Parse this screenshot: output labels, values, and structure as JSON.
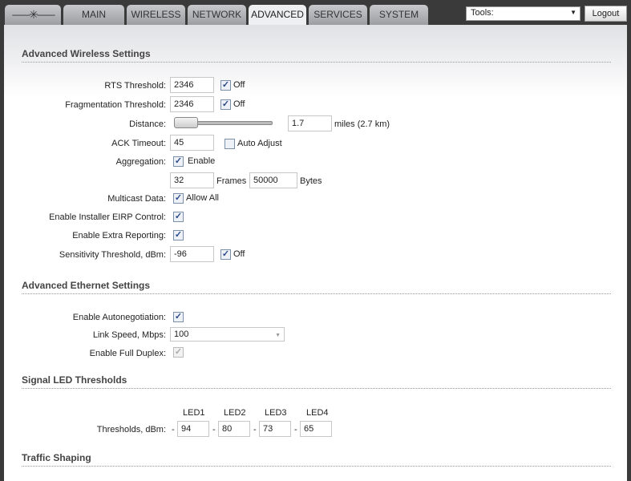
{
  "tabs": [
    "MAIN",
    "WIRELESS",
    "NETWORK",
    "ADVANCED",
    "SERVICES",
    "SYSTEM"
  ],
  "active_tab": "ADVANCED",
  "tools": {
    "label": "Tools:"
  },
  "logout": "Logout",
  "wireless": {
    "title": "Advanced Wireless Settings",
    "rts_label": "RTS Threshold:",
    "rts_value": "2346",
    "rts_off": "Off",
    "frag_label": "Fragmentation Threshold:",
    "frag_value": "2346",
    "frag_off": "Off",
    "distance_label": "Distance:",
    "distance_value": "1.7",
    "distance_unit": "miles (2.7 km)",
    "ack_label": "ACK Timeout:",
    "ack_value": "45",
    "ack_auto": "Auto Adjust",
    "agg_label": "Aggregation:",
    "agg_enable": "Enable",
    "agg_frames": "32",
    "frames_label": "Frames",
    "agg_bytes": "50000",
    "bytes_label": "Bytes",
    "mcast_label": "Multicast Data:",
    "mcast_allow": "Allow All",
    "eirp_label": "Enable Installer EIRP Control:",
    "extra_label": "Enable Extra Reporting:",
    "sens_label": "Sensitivity Threshold, dBm:",
    "sens_value": "-96",
    "sens_off": "Off"
  },
  "ethernet": {
    "title": "Advanced Ethernet Settings",
    "autoneg_label": "Enable Autonegotiation:",
    "speed_label": "Link Speed, Mbps:",
    "speed_value": "100",
    "duplex_label": "Enable Full Duplex:"
  },
  "led": {
    "title": "Signal LED Thresholds",
    "row_label": "Thresholds, dBm:",
    "headers": [
      "LED1",
      "LED2",
      "LED3",
      "LED4"
    ],
    "values": [
      "94",
      "80",
      "73",
      "65"
    ],
    "dash": "-"
  },
  "traffic": {
    "title": "Traffic Shaping"
  }
}
